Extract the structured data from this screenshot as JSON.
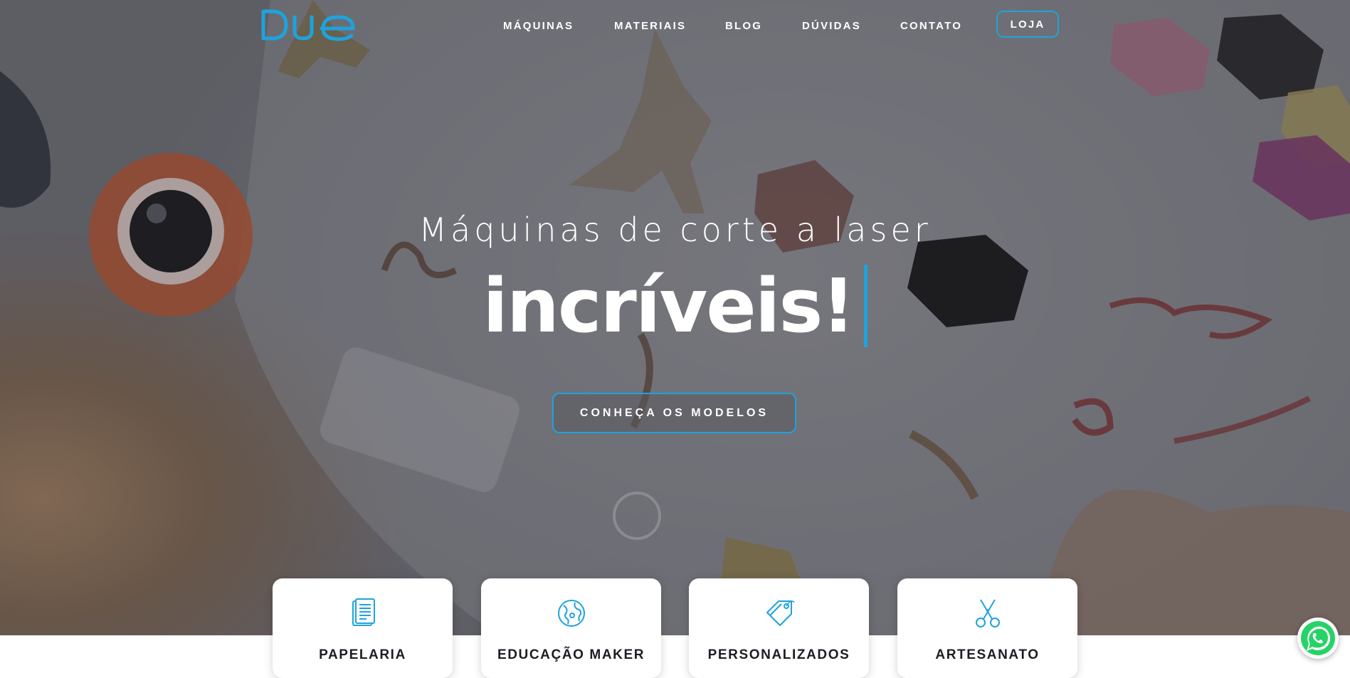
{
  "brand": {
    "logo_text": "DUE",
    "accent_color": "#1ea3dd"
  },
  "nav": {
    "items": [
      {
        "label": "MÁQUINAS"
      },
      {
        "label": "MATERIAIS"
      },
      {
        "label": "BLOG"
      },
      {
        "label": "DÚVIDAS"
      },
      {
        "label": "CONTATO"
      }
    ],
    "store_label": "LOJA"
  },
  "hero": {
    "subtitle": "Máquinas de corte a laser",
    "title": "incríveis!",
    "cta_label": "CONHEÇA OS MODELOS"
  },
  "categories": [
    {
      "label": "PAPELARIA",
      "icon": "document-icon"
    },
    {
      "label": "EDUCAÇÃO MAKER",
      "icon": "globe-icon"
    },
    {
      "label": "PERSONALIZADOS",
      "icon": "tag-icon"
    },
    {
      "label": "ARTESANATO",
      "icon": "scissors-icon"
    }
  ],
  "whatsapp": {
    "icon": "whatsapp-icon",
    "color": "#25d366"
  }
}
